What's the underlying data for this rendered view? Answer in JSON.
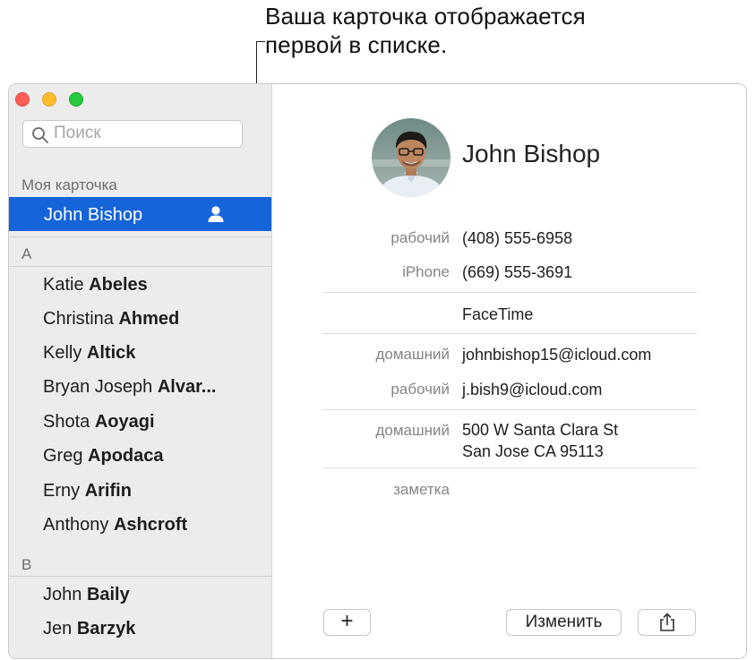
{
  "callout": {
    "line1": "Ваша карточка отображается",
    "line2": "первой в списке."
  },
  "search": {
    "placeholder": "Поиск"
  },
  "sidebar": {
    "my_card_label": "Моя карточка",
    "my_card_name": "John Bishop",
    "sections": [
      {
        "letter": "A",
        "contacts": [
          {
            "first": "Katie",
            "last": "Abeles"
          },
          {
            "first": "Christina",
            "last": "Ahmed"
          },
          {
            "first": "Kelly",
            "last": "Altick"
          },
          {
            "first": "Bryan Joseph",
            "last": "Alvar..."
          },
          {
            "first": "Shota",
            "last": "Aoyagi"
          },
          {
            "first": "Greg",
            "last": "Apodaca"
          },
          {
            "first": "Erny",
            "last": "Arifin"
          },
          {
            "first": "Anthony",
            "last": "Ashcroft"
          }
        ]
      },
      {
        "letter": "B",
        "contacts": [
          {
            "first": "John",
            "last": "Baily"
          },
          {
            "first": "Jen",
            "last": "Barzyk"
          }
        ]
      }
    ]
  },
  "card": {
    "name": "John Bishop",
    "fields": [
      {
        "label": "рабочий",
        "value": "(408) 555-6958"
      },
      {
        "label": "iPhone",
        "value": "(669) 555-3691"
      },
      {
        "label": "",
        "value": "FaceTime"
      },
      {
        "label": "домашний",
        "value": "johnbishop15@icloud.com"
      },
      {
        "label": "рабочий",
        "value": "j.bish9@icloud.com"
      },
      {
        "label": "домашний",
        "value_line1": "500 W Santa Clara St",
        "value_line2": "San Jose CA 95113"
      },
      {
        "label": "заметка",
        "value": ""
      }
    ]
  },
  "buttons": {
    "add": "+",
    "edit": "Изменить",
    "share_icon": "share-icon"
  },
  "colors": {
    "selection": "#1664d9",
    "sidebar_bg": "#ececec",
    "close": "#ff5f57",
    "minimize": "#febc2e",
    "zoom": "#28c840"
  }
}
